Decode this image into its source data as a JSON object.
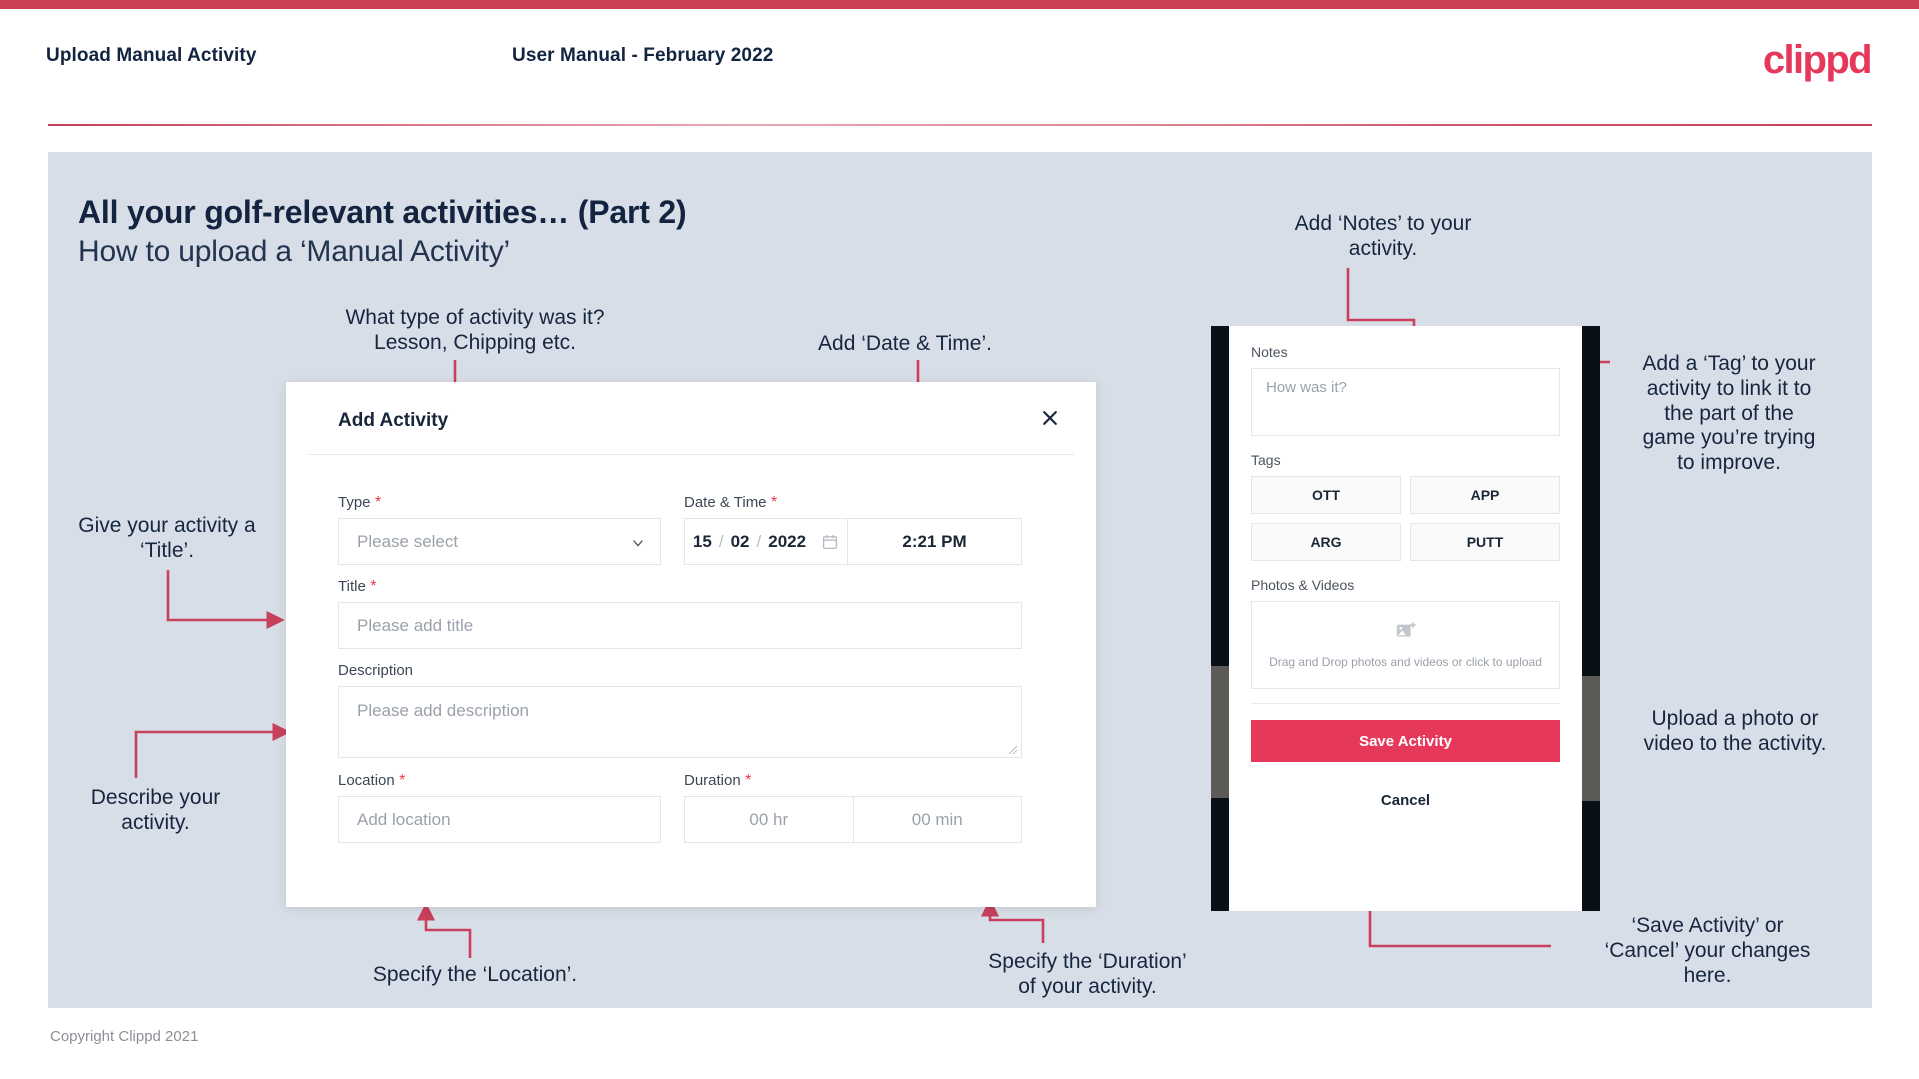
{
  "header": {
    "title": "Upload Manual Activity",
    "subtitle": "User Manual - February 2022",
    "logo": "clippd",
    "accent": "#e5385b"
  },
  "slide": {
    "heading": "All your golf-relevant activities… (Part 2)",
    "subheading": "How to upload a ‘Manual Activity’"
  },
  "dialog": {
    "title": "Add Activity",
    "close_icon": "close-icon",
    "fields": {
      "type": {
        "label": "Type",
        "required": true,
        "placeholder": "Please select"
      },
      "datetime": {
        "label": "Date & Time",
        "required": true,
        "day": "15",
        "month": "02",
        "year": "2022",
        "separator": "/",
        "time": "2:21 PM",
        "calendar_icon": "calendar-icon"
      },
      "title": {
        "label": "Title",
        "required": true,
        "placeholder": "Please add title"
      },
      "description": {
        "label": "Description",
        "required": false,
        "placeholder": "Please add description"
      },
      "location": {
        "label": "Location",
        "required": true,
        "placeholder": "Add location"
      },
      "duration": {
        "label": "Duration",
        "required": true,
        "hours": "00 hr",
        "minutes": "00 min"
      }
    }
  },
  "phone": {
    "notes": {
      "label": "Notes",
      "placeholder": "How was it?"
    },
    "tags": {
      "label": "Tags",
      "items": [
        "OTT",
        "APP",
        "ARG",
        "PUTT"
      ]
    },
    "photos": {
      "label": "Photos & Videos",
      "icon": "add-image-icon",
      "dropzone_text": "Drag and Drop photos and videos or click to upload"
    },
    "save_label": "Save Activity",
    "cancel_label": "Cancel",
    "save_color": "#e5385b"
  },
  "annotations": {
    "type": "What type of activity was it?\nLesson, Chipping etc.",
    "datetime": "Add ‘Date & Time’.",
    "title": "Give your activity a\n‘Title’.",
    "description": "Describe your\nactivity.",
    "location": "Specify the ‘Location’.",
    "duration": "Specify the ‘Duration’\nof your activity.",
    "notes": "Add ‘Notes’ to your\nactivity.",
    "tags": "Add a ‘Tag’ to your\nactivity to link it to\nthe part of the\ngame you’re trying\nto improve.",
    "photos": "Upload a photo or\nvideo to the activity.",
    "save": "‘Save Activity’ or\n‘Cancel’ your changes\nhere.",
    "line_color": "#c8405c"
  },
  "footer": {
    "copyright": "Copyright Clippd 2021"
  }
}
